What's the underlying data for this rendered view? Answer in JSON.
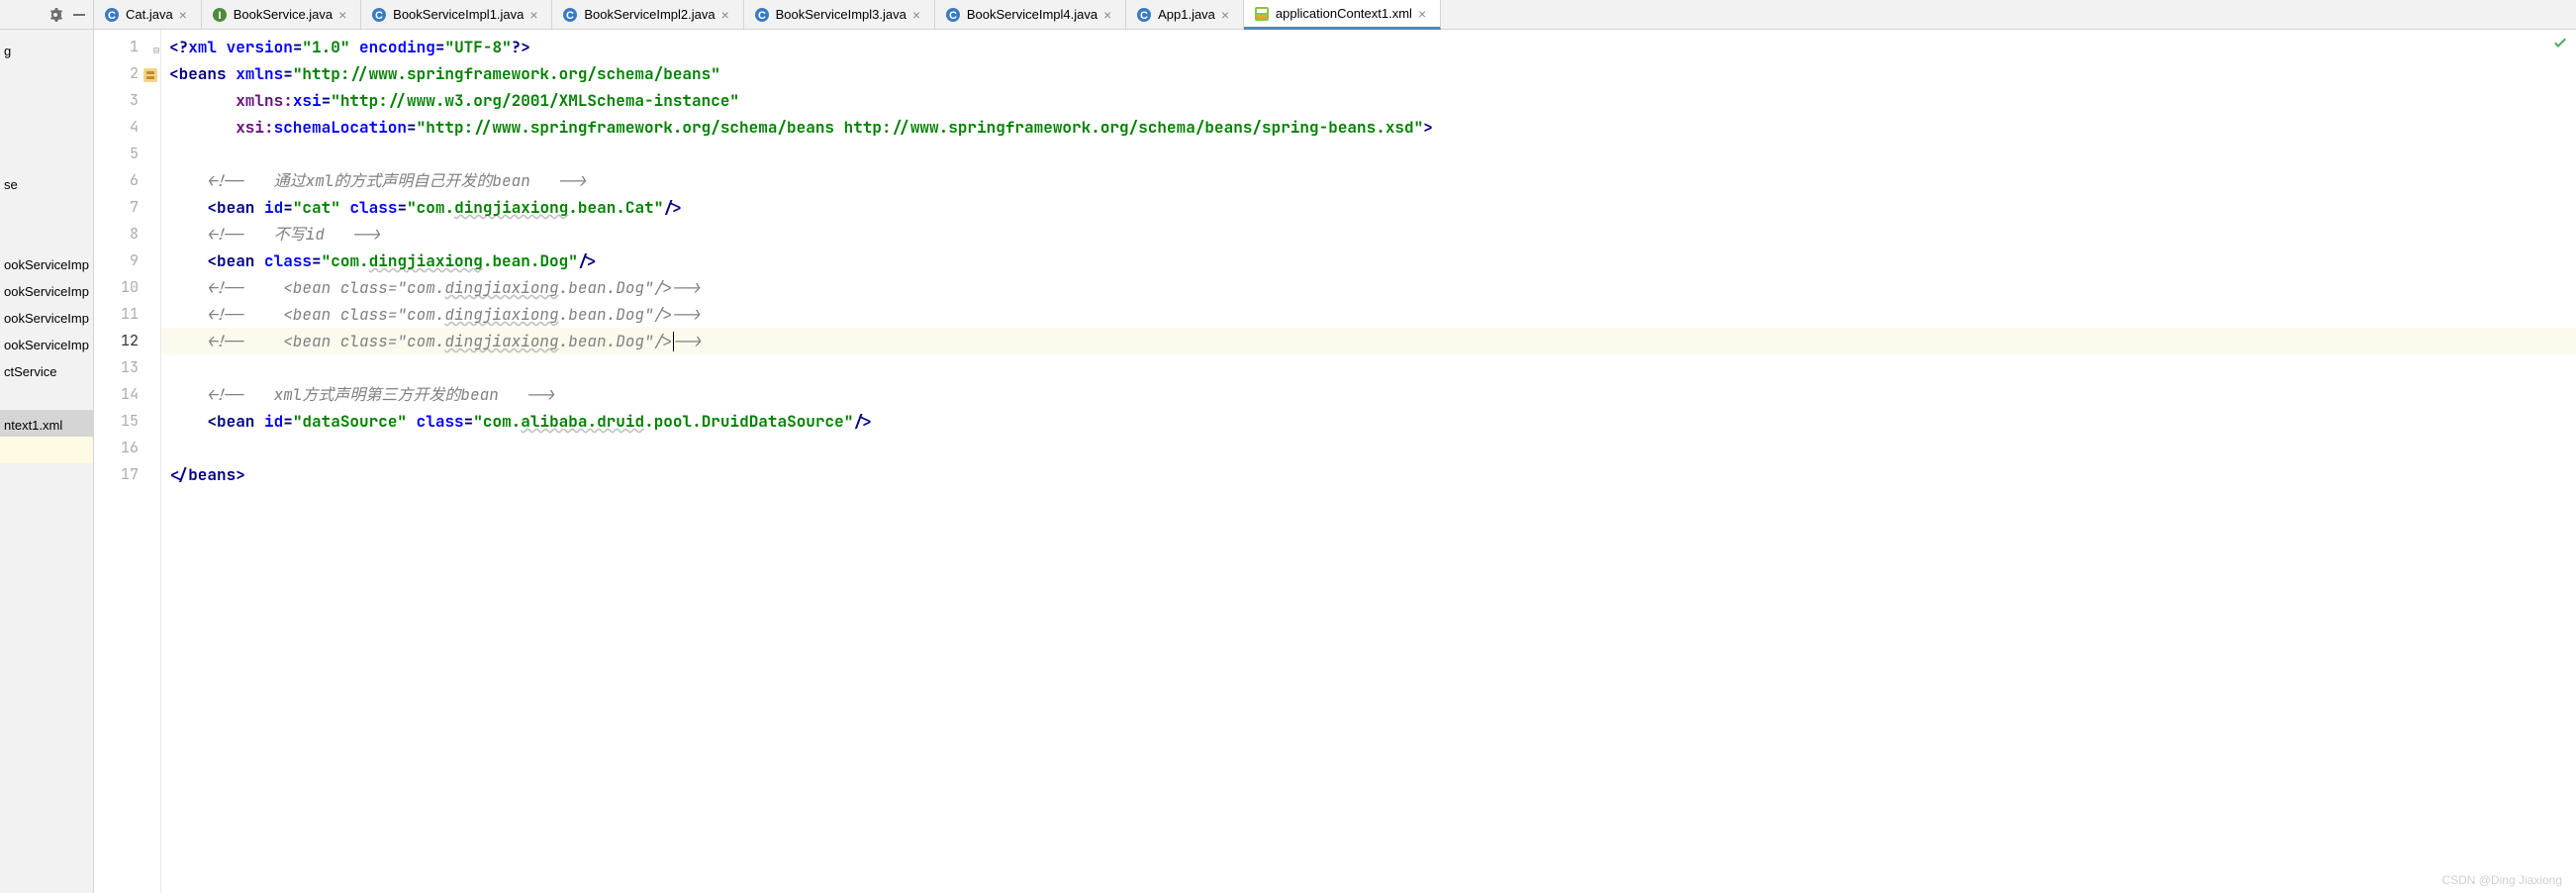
{
  "toolbar": {
    "gear_icon": "gear-icon",
    "minimize_icon": "minimize-icon"
  },
  "tabs": [
    {
      "label": "Cat.java",
      "icon_type": "class",
      "active": false
    },
    {
      "label": "BookService.java",
      "icon_type": "interface",
      "active": false
    },
    {
      "label": "BookServiceImpl1.java",
      "icon_type": "class",
      "active": false
    },
    {
      "label": "BookServiceImpl2.java",
      "icon_type": "class",
      "active": false
    },
    {
      "label": "BookServiceImpl3.java",
      "icon_type": "class",
      "active": false
    },
    {
      "label": "BookServiceImpl4.java",
      "icon_type": "class",
      "active": false
    },
    {
      "label": "App1.java",
      "icon_type": "class",
      "active": false
    },
    {
      "label": "applicationContext1.xml",
      "icon_type": "xml",
      "active": true
    }
  ],
  "project_tree": {
    "items": [
      {
        "label": "g",
        "selected": false,
        "highlighted": false
      },
      {
        "label": "",
        "selected": false,
        "highlighted": false
      },
      {
        "label": "",
        "selected": false,
        "highlighted": false
      },
      {
        "label": "",
        "selected": false,
        "highlighted": false
      },
      {
        "label": "",
        "selected": false,
        "highlighted": false
      },
      {
        "label": "se",
        "selected": false,
        "highlighted": false
      },
      {
        "label": "",
        "selected": false,
        "highlighted": false
      },
      {
        "label": "",
        "selected": false,
        "highlighted": false
      },
      {
        "label": "ookServiceImp",
        "selected": false,
        "highlighted": false
      },
      {
        "label": "ookServiceImp",
        "selected": false,
        "highlighted": false
      },
      {
        "label": "ookServiceImp",
        "selected": false,
        "highlighted": false
      },
      {
        "label": "ookServiceImp",
        "selected": false,
        "highlighted": false
      },
      {
        "label": "ctService",
        "selected": false,
        "highlighted": false
      },
      {
        "label": "",
        "selected": false,
        "highlighted": false
      },
      {
        "label": "ntext1.xml",
        "selected": true,
        "highlighted": false
      },
      {
        "label": "",
        "selected": false,
        "highlighted": true
      }
    ]
  },
  "editor": {
    "current_line": 12,
    "total_lines": 17,
    "lines": [
      {
        "num": 1,
        "tokens": [
          {
            "t": "tag",
            "v": "<?"
          },
          {
            "t": "attr-name",
            "v": "xml version"
          },
          {
            "t": "tag",
            "v": "="
          },
          {
            "t": "str",
            "v": "\"1.0\""
          },
          {
            "t": "tag",
            "v": " "
          },
          {
            "t": "attr-name",
            "v": "encoding"
          },
          {
            "t": "tag",
            "v": "="
          },
          {
            "t": "str",
            "v": "\"UTF-8\""
          },
          {
            "t": "tag",
            "v": "?>"
          }
        ]
      },
      {
        "num": 2,
        "fold_open": true,
        "beans_icon": true,
        "tokens": [
          {
            "t": "tag",
            "v": "<beans "
          },
          {
            "t": "attr-name",
            "v": "xmlns"
          },
          {
            "t": "tag",
            "v": "="
          },
          {
            "t": "str",
            "v": "\"http://www.springframework.org/schema/beans\""
          }
        ]
      },
      {
        "num": 3,
        "tokens": [
          {
            "t": "plain",
            "v": "       "
          },
          {
            "t": "ns-prefix",
            "v": "xmlns:"
          },
          {
            "t": "attr-name",
            "v": "xsi"
          },
          {
            "t": "tag",
            "v": "="
          },
          {
            "t": "str",
            "v": "\"http://www.w3.org/2001/XMLSchema-instance\""
          }
        ]
      },
      {
        "num": 4,
        "tokens": [
          {
            "t": "plain",
            "v": "       "
          },
          {
            "t": "ns-prefix",
            "v": "xsi:"
          },
          {
            "t": "attr-name",
            "v": "schemaLocation"
          },
          {
            "t": "tag",
            "v": "="
          },
          {
            "t": "str",
            "v": "\"http://www.springframework.org/schema/beans http://www.springframework.org/schema/beans/spring-beans.xsd\""
          },
          {
            "t": "tag",
            "v": ">"
          }
        ]
      },
      {
        "num": 5,
        "tokens": []
      },
      {
        "num": 6,
        "tokens": [
          {
            "t": "plain",
            "v": "    "
          },
          {
            "t": "comment",
            "v": "<!--   通过xml的方式声明自己开发的bean   -->"
          }
        ]
      },
      {
        "num": 7,
        "tokens": [
          {
            "t": "plain",
            "v": "    "
          },
          {
            "t": "tag",
            "v": "<bean "
          },
          {
            "t": "attr-name",
            "v": "id"
          },
          {
            "t": "tag",
            "v": "="
          },
          {
            "t": "str",
            "v": "\"cat\""
          },
          {
            "t": "tag",
            "v": " "
          },
          {
            "t": "attr-name",
            "v": "class"
          },
          {
            "t": "tag",
            "v": "="
          },
          {
            "t": "str",
            "v": "\"com."
          },
          {
            "t": "str-wavy",
            "v": "dingjiaxiong"
          },
          {
            "t": "str",
            "v": ".bean.Cat\""
          },
          {
            "t": "tag",
            "v": "/>"
          }
        ]
      },
      {
        "num": 8,
        "tokens": [
          {
            "t": "plain",
            "v": "    "
          },
          {
            "t": "comment",
            "v": "<!--   不写id   -->"
          }
        ]
      },
      {
        "num": 9,
        "tokens": [
          {
            "t": "plain",
            "v": "    "
          },
          {
            "t": "tag",
            "v": "<bean "
          },
          {
            "t": "attr-name",
            "v": "class"
          },
          {
            "t": "tag",
            "v": "="
          },
          {
            "t": "str",
            "v": "\"com."
          },
          {
            "t": "str-wavy",
            "v": "dingjiaxiong"
          },
          {
            "t": "str",
            "v": ".bean.Dog\""
          },
          {
            "t": "tag",
            "v": "/>"
          }
        ]
      },
      {
        "num": 10,
        "tokens": [
          {
            "t": "plain",
            "v": "    "
          },
          {
            "t": "comment",
            "v": "<!--    <bean class=\"com."
          },
          {
            "t": "comment-wavy",
            "v": "dingjiaxiong"
          },
          {
            "t": "comment",
            "v": ".bean.Dog\"/>-->"
          }
        ]
      },
      {
        "num": 11,
        "tokens": [
          {
            "t": "plain",
            "v": "    "
          },
          {
            "t": "comment",
            "v": "<!--    <bean class=\"com."
          },
          {
            "t": "comment-wavy",
            "v": "dingjiaxiong"
          },
          {
            "t": "comment",
            "v": ".bean.Dog\"/>-->"
          }
        ]
      },
      {
        "num": 12,
        "current": true,
        "tokens": [
          {
            "t": "plain",
            "v": "    "
          },
          {
            "t": "comment",
            "v": "<!--    <bean class=\"com."
          },
          {
            "t": "comment-wavy",
            "v": "dingjiaxiong"
          },
          {
            "t": "comment",
            "v": ".bean.Dog\"/>"
          },
          {
            "t": "cursor",
            "v": ""
          },
          {
            "t": "comment",
            "v": "-->"
          }
        ]
      },
      {
        "num": 13,
        "tokens": []
      },
      {
        "num": 14,
        "tokens": [
          {
            "t": "plain",
            "v": "    "
          },
          {
            "t": "comment",
            "v": "<!--   xml方式声明第三方开发的bean   -->"
          }
        ]
      },
      {
        "num": 15,
        "tokens": [
          {
            "t": "plain",
            "v": "    "
          },
          {
            "t": "tag",
            "v": "<bean "
          },
          {
            "t": "attr-name",
            "v": "id"
          },
          {
            "t": "tag",
            "v": "="
          },
          {
            "t": "str",
            "v": "\"dataSource\""
          },
          {
            "t": "tag",
            "v": " "
          },
          {
            "t": "attr-name",
            "v": "class"
          },
          {
            "t": "tag",
            "v": "="
          },
          {
            "t": "str",
            "v": "\"com."
          },
          {
            "t": "str-wavy",
            "v": "alibaba.druid"
          },
          {
            "t": "str",
            "v": ".pool.DruidDataSource\""
          },
          {
            "t": "tag",
            "v": "/>"
          }
        ]
      },
      {
        "num": 16,
        "tokens": []
      },
      {
        "num": 17,
        "fold_close": true,
        "tokens": [
          {
            "t": "tag",
            "v": "</beans>"
          }
        ]
      }
    ]
  },
  "watermark": "CSDN @Ding Jiaxiong"
}
